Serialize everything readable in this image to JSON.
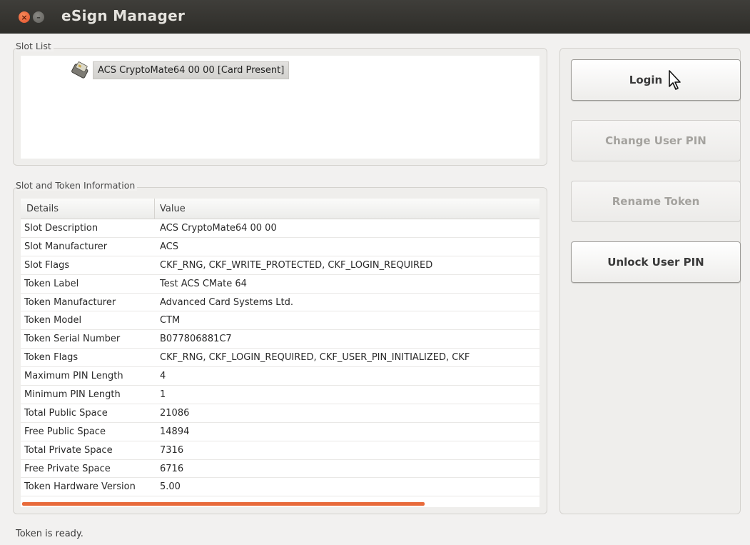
{
  "window": {
    "title": "eSign Manager"
  },
  "slot_list": {
    "group_title": "Slot List",
    "items": [
      {
        "label": "ACS CryptoMate64 00 00 [Card Present]",
        "icon": "card-reader-icon"
      }
    ]
  },
  "token_info": {
    "group_title": "Slot and Token Information",
    "columns": [
      "Details",
      "Value"
    ],
    "rows": [
      [
        "Slot Description",
        "ACS CryptoMate64 00 00"
      ],
      [
        "Slot Manufacturer",
        "ACS"
      ],
      [
        "Slot Flags",
        "CKF_RNG, CKF_WRITE_PROTECTED, CKF_LOGIN_REQUIRED"
      ],
      [
        "Token Label",
        "Test ACS CMate 64"
      ],
      [
        "Token Manufacturer",
        "Advanced Card Systems Ltd."
      ],
      [
        "Token Model",
        "CTM"
      ],
      [
        "Token Serial Number",
        "B077806881C7"
      ],
      [
        "Token Flags",
        "CKF_RNG, CKF_LOGIN_REQUIRED, CKF_USER_PIN_INITIALIZED, CKF"
      ],
      [
        "Maximum PIN Length",
        "4"
      ],
      [
        "Minimum PIN Length",
        "1"
      ],
      [
        "Total Public Space",
        "21086"
      ],
      [
        "Free Public Space",
        "14894"
      ],
      [
        "Total Private Space",
        "7316"
      ],
      [
        "Free Private Space",
        "6716"
      ],
      [
        "Token Hardware Version",
        "5.00"
      ]
    ]
  },
  "buttons": {
    "login": "Login",
    "change_pin": "Change User PIN",
    "rename_token": "Rename Token",
    "unlock_pin": "Unlock User PIN"
  },
  "status": {
    "text": "Token is ready."
  },
  "colors": {
    "accent": "#e86a3a",
    "titlebar": "#3a3935"
  }
}
